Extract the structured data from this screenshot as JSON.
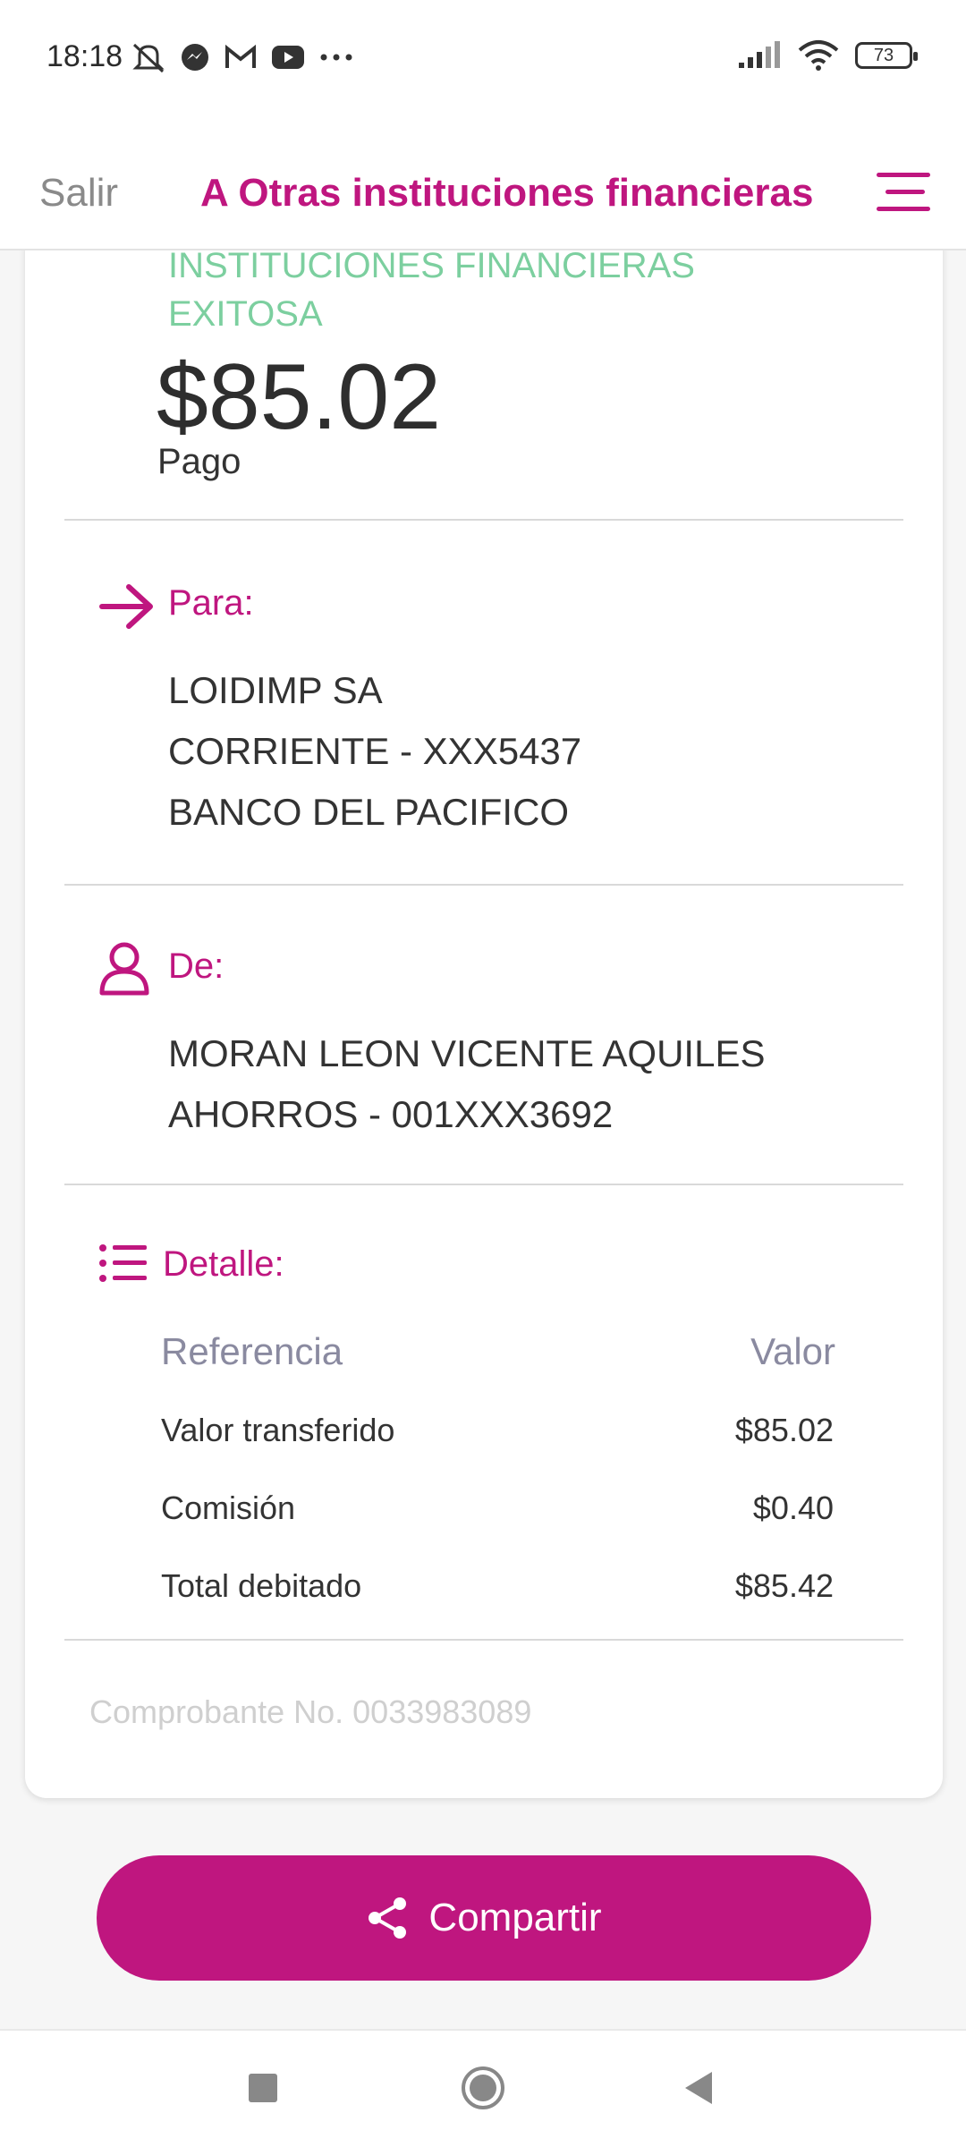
{
  "status_bar": {
    "time": "18:18",
    "battery": "73",
    "icons_left": [
      "mute-icon",
      "messenger-icon",
      "gmail-icon",
      "youtube-icon",
      "more-icon"
    ],
    "icons_right": [
      "signal-icon",
      "wifi-icon",
      "battery-icon"
    ]
  },
  "header": {
    "exit_label": "Salir",
    "title": "A Otras instituciones financieras",
    "menu_icon": "hamburger-menu-icon"
  },
  "receipt": {
    "status_line1": "INSTITUCIONES FINANCIERAS",
    "status_line2": "EXITOSA",
    "status_color": "#7ccf9f",
    "amount": "$85.02",
    "amount_label": "Pago"
  },
  "to": {
    "title": "Para:",
    "icon": "arrow-right-icon",
    "lines": [
      "LOIDIMP SA",
      "CORRIENTE - XXX5437",
      "BANCO DEL PACIFICO"
    ]
  },
  "from": {
    "title": "De:",
    "icon": "user-icon",
    "lines": [
      "MORAN LEON VICENTE AQUILES",
      "AHORROS - 001XXX3692"
    ]
  },
  "detail": {
    "title": "Detalle:",
    "icon": "list-icon",
    "columns": [
      "Referencia",
      "Valor"
    ],
    "rows": [
      {
        "label": "Valor transferido",
        "value": "$85.02"
      },
      {
        "label": "Comisión",
        "value": "$0.40"
      },
      {
        "label": "Total debitado",
        "value": "$85.42"
      }
    ]
  },
  "voucher_text": "Comprobante No. 0033983089",
  "share_button": {
    "label": "Compartir",
    "icon": "share-icon"
  },
  "colors": {
    "accent": "#bf167f",
    "success": "#7ccf9f",
    "text": "#333333"
  },
  "nav": {
    "icons": [
      "recent-apps-icon",
      "home-icon",
      "back-icon"
    ]
  }
}
